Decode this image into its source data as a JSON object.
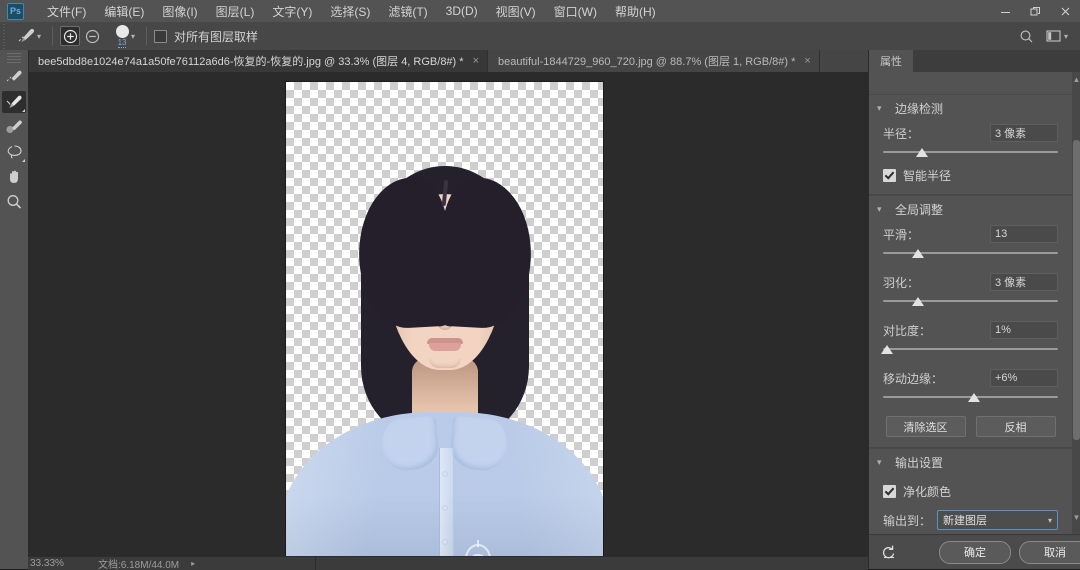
{
  "app": {
    "logo_text": "Ps",
    "menus": [
      {
        "label": "文件(F)"
      },
      {
        "label": "编辑(E)"
      },
      {
        "label": "图像(I)"
      },
      {
        "label": "图层(L)"
      },
      {
        "label": "文字(Y)"
      },
      {
        "label": "选择(S)"
      },
      {
        "label": "滤镜(T)"
      },
      {
        "label": "3D(D)"
      },
      {
        "label": "视图(V)"
      },
      {
        "label": "窗口(W)"
      },
      {
        "label": "帮助(H)"
      }
    ],
    "window_controls": {
      "minimize": "minimize-icon",
      "restore": "restore-icon",
      "close": "close-icon"
    }
  },
  "options_bar": {
    "tool_icon": "refine-edge-brush-icon",
    "tool_preset_caret": "▾",
    "mode_add": "add-to-selection-icon",
    "mode_subtract": "subtract-from-selection-icon",
    "brush_size": "13",
    "brush_caret": "▾",
    "sample_all_layers_label": "对所有图层取样",
    "sample_all_layers_checked": false,
    "search_icon": "search-icon",
    "workspace_icon": "workspace-switcher-icon",
    "workspace_caret": "▾"
  },
  "tabs": [
    {
      "title": "bee5dbd8e1024e74a1a50fe76112a6d6-恢复的-恢复的.jpg @ 33.3% (图层 4, RGB/8#) *",
      "close": "×",
      "active": true
    },
    {
      "title": "beautiful-1844729_960_720.jpg @ 88.7% (图层 1, RGB/8#) *",
      "close": "×",
      "active": false
    }
  ],
  "toolbar": {
    "tools": [
      {
        "name": "quick-selection-tool",
        "icon": "quick-selection-brush-icon",
        "selected": false
      },
      {
        "name": "refine-edge-brush-tool",
        "icon": "refine-edge-brush-icon",
        "selected": true
      },
      {
        "name": "brush-tool",
        "icon": "brush-icon",
        "selected": false
      },
      {
        "name": "lasso-tool",
        "icon": "lasso-icon",
        "selected": false
      },
      {
        "name": "hand-tool",
        "icon": "hand-icon",
        "selected": false
      },
      {
        "name": "zoom-tool",
        "icon": "magnifier-icon",
        "selected": false
      }
    ]
  },
  "properties_panel": {
    "tab_label": "属性",
    "sections": [
      {
        "title": "边缘检测",
        "collapse_icon": "▾",
        "radius": {
          "label": "半径：",
          "value": "3 像素",
          "slider_percent": 22
        },
        "smart_radius": {
          "label": "智能半径",
          "checked": true
        }
      },
      {
        "title": "全局调整",
        "collapse_icon": "▾",
        "smooth": {
          "label": "平滑：",
          "value": "13",
          "slider_percent": 20
        },
        "feather": {
          "label": "羽化：",
          "value": "3 像素",
          "slider_percent": 20
        },
        "contrast": {
          "label": "对比度：",
          "value": "1%",
          "slider_percent": 2
        },
        "shift_edge": {
          "label": "移动边缘：",
          "value": "+6%",
          "slider_percent": 52
        },
        "buttons": [
          {
            "label": "清除选区"
          },
          {
            "label": "反相"
          }
        ]
      },
      {
        "title": "输出设置",
        "collapse_icon": "▾",
        "decontaminate": {
          "label": "净化颜色",
          "checked": true
        },
        "output_to": {
          "label": "输出到：",
          "value": "新建图层",
          "caret": "▾"
        }
      }
    ],
    "footer": {
      "reset_icon": "reset-icon",
      "ok_label": "确定",
      "cancel_label": "取消"
    },
    "scrollbar": {
      "up_arrow": "▲",
      "down_arrow": "▼"
    }
  },
  "status_bar": {
    "zoom": "33.33%",
    "doc_info": "文档:6.18M/44.0M",
    "caret": "▸"
  },
  "canvas": {
    "document_name": "bee5dbd8e1024e74a1a50fe76112a6d6-恢复的-恢复的.jpg",
    "zoom_level": "33.3%",
    "background": "transparency-checkerboard",
    "content": "portrait-photo-id-blue-shirt"
  },
  "colors": {
    "menu_bg": "#535353",
    "options_bg": "#474747",
    "canvas_bg": "#2b2b2b",
    "panel_bg": "#535353",
    "accent_blue": "#5f8fc9",
    "shirt_blue": "#b9cbe8",
    "hair": "#24202c",
    "skin": "#f2d4c2"
  }
}
